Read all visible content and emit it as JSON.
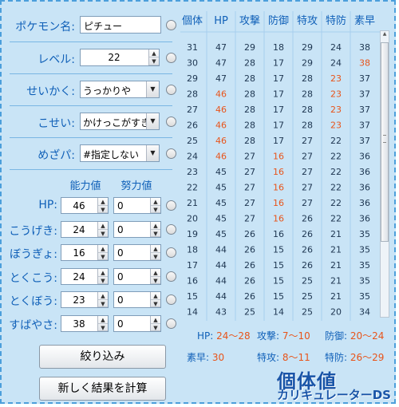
{
  "form": {
    "pokemon_label": "ポケモン名:",
    "pokemon_value": "ピチュー",
    "level_label": "レベル:",
    "level_value": "22",
    "nature_label": "せいかく:",
    "nature_value": "うっかりや",
    "trait_label": "こせい:",
    "trait_value": "かけっこがすき",
    "hp_type_label": "めざパ:",
    "hp_type_value": "#指定しない"
  },
  "stats": {
    "col_stat": "能力値",
    "col_ev": "努力値",
    "rows": [
      {
        "label": "HP:",
        "stat": "46",
        "ev": "0"
      },
      {
        "label": "こうげき:",
        "stat": "24",
        "ev": "0"
      },
      {
        "label": "ぼうぎょ:",
        "stat": "16",
        "ev": "0"
      },
      {
        "label": "とくこう:",
        "stat": "24",
        "ev": "0"
      },
      {
        "label": "とくぼう:",
        "stat": "23",
        "ev": "0"
      },
      {
        "label": "すばやさ:",
        "stat": "38",
        "ev": "0"
      }
    ]
  },
  "buttons": {
    "filter": "絞り込み",
    "recalc": "新しく結果を計算"
  },
  "table": {
    "headers": [
      "個体",
      "HP",
      "攻撃",
      "防御",
      "特攻",
      "特防",
      "素早"
    ],
    "rows": [
      [
        31,
        47,
        29,
        18,
        29,
        24,
        38
      ],
      [
        30,
        47,
        28,
        17,
        29,
        24,
        38
      ],
      [
        29,
        47,
        28,
        17,
        28,
        23,
        37
      ],
      [
        28,
        46,
        28,
        17,
        28,
        23,
        37
      ],
      [
        27,
        46,
        28,
        17,
        28,
        23,
        37
      ],
      [
        26,
        46,
        28,
        17,
        28,
        23,
        37
      ],
      [
        25,
        46,
        28,
        17,
        27,
        22,
        37
      ],
      [
        24,
        46,
        27,
        16,
        27,
        22,
        36
      ],
      [
        23,
        45,
        27,
        16,
        27,
        22,
        36
      ],
      [
        22,
        45,
        27,
        16,
        27,
        22,
        36
      ],
      [
        21,
        45,
        27,
        16,
        27,
        22,
        36
      ],
      [
        20,
        45,
        27,
        16,
        26,
        22,
        36
      ],
      [
        19,
        45,
        26,
        16,
        26,
        21,
        35
      ],
      [
        18,
        44,
        26,
        15,
        26,
        21,
        35
      ],
      [
        17,
        44,
        26,
        15,
        26,
        21,
        35
      ],
      [
        16,
        44,
        26,
        15,
        25,
        21,
        35
      ],
      [
        15,
        44,
        26,
        15,
        25,
        21,
        35
      ],
      [
        14,
        43,
        25,
        14,
        25,
        20,
        34
      ]
    ],
    "highlights": [
      [
        1,
        6
      ],
      [
        2,
        5
      ],
      [
        3,
        1
      ],
      [
        3,
        5
      ],
      [
        4,
        1
      ],
      [
        4,
        5
      ],
      [
        5,
        1
      ],
      [
        5,
        5
      ],
      [
        6,
        1
      ],
      [
        7,
        1
      ],
      [
        7,
        3
      ],
      [
        8,
        3
      ],
      [
        9,
        3
      ],
      [
        10,
        3
      ],
      [
        11,
        3
      ]
    ]
  },
  "results": {
    "hp_label": "HP:",
    "hp_range": "24〜28",
    "atk_label": "攻撃:",
    "atk_range": "7〜10",
    "def_label": "防御:",
    "def_range": "20〜24",
    "spe_label": "素早:",
    "spe_value": "30",
    "spa_label": "特攻:",
    "spa_range": "8〜11",
    "spd_label": "特防:",
    "spd_range": "26〜29"
  },
  "logo": {
    "line1": "個体値",
    "line2": "カリキュレーターDS"
  },
  "colors": {
    "accent": "#1060b8",
    "highlight": "#e8541a",
    "background": "#c9e4f6"
  }
}
